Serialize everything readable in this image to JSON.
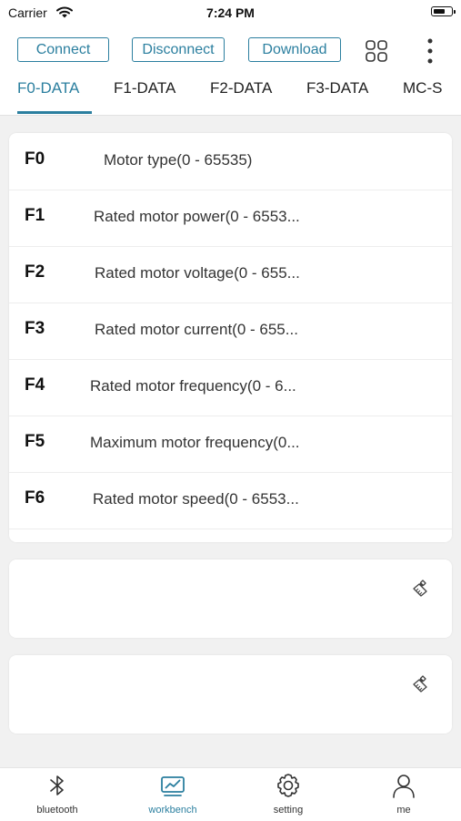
{
  "status_bar": {
    "carrier": "Carrier",
    "time": "7:24 PM"
  },
  "toolbar": {
    "connect": "Connect",
    "disconnect": "Disconnect",
    "download": "Download"
  },
  "tabs": [
    {
      "label": "F0-DATA",
      "active": true
    },
    {
      "label": "F1-DATA"
    },
    {
      "label": "F2-DATA"
    },
    {
      "label": "F3-DATA"
    },
    {
      "label": "MC-S"
    }
  ],
  "params": [
    {
      "code": "F0",
      "desc": "Motor type(0 - 65535)"
    },
    {
      "code": "F1",
      "desc": "Rated motor power(0 - 6553..."
    },
    {
      "code": "F2",
      "desc": "Rated motor voltage(0 - 655..."
    },
    {
      "code": "F3",
      "desc": "Rated motor current(0 - 655..."
    },
    {
      "code": "F4",
      "desc": "Rated motor frequency(0 - 6..."
    },
    {
      "code": "F5",
      "desc": "Maximum motor frequency(0..."
    },
    {
      "code": "F6",
      "desc": "Rated motor speed(0 - 6553..."
    }
  ],
  "log_panels": [
    {
      "icon": "clear-brush-icon"
    },
    {
      "icon": "clear-brush-icon"
    }
  ],
  "bottom_nav": [
    {
      "label": "bluetooth",
      "icon": "bluetooth-icon"
    },
    {
      "label": "workbench",
      "icon": "workbench-icon",
      "active": true
    },
    {
      "label": "setting",
      "icon": "gear-icon"
    },
    {
      "label": "me",
      "icon": "user-icon"
    }
  ],
  "colors": {
    "accent": "#2b7f9f",
    "background": "#f1f1f1",
    "card": "#ffffff"
  }
}
